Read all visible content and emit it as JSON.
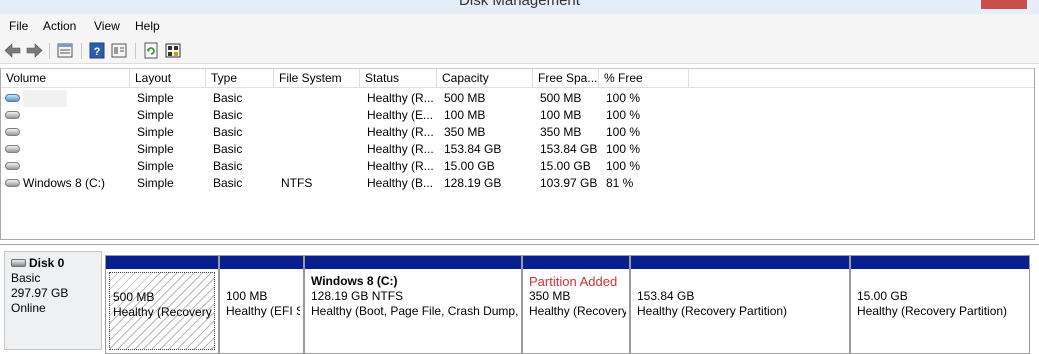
{
  "window": {
    "title": "Disk Management"
  },
  "menu": [
    "File",
    "Action",
    "View",
    "Help"
  ],
  "toolbar": {
    "icons": [
      "back-arrow-icon",
      "forward-arrow-icon",
      "disk-list-icon",
      "help-icon",
      "properties-icon",
      "refresh-icon",
      "rescan-icon"
    ]
  },
  "columns": [
    "Volume",
    "Layout",
    "Type",
    "File System",
    "Status",
    "Capacity",
    "Free Spa...",
    "% Free"
  ],
  "volumes": [
    {
      "volume": "",
      "layout": "Simple",
      "type": "Basic",
      "fs": "",
      "status": "Healthy (R...",
      "capacity": "500 MB",
      "free": "500 MB",
      "pct": "100 %"
    },
    {
      "volume": "",
      "layout": "Simple",
      "type": "Basic",
      "fs": "",
      "status": "Healthy (E...",
      "capacity": "100 MB",
      "free": "100 MB",
      "pct": "100 %"
    },
    {
      "volume": "",
      "layout": "Simple",
      "type": "Basic",
      "fs": "",
      "status": "Healthy (R...",
      "capacity": "350 MB",
      "free": "350 MB",
      "pct": "100 %"
    },
    {
      "volume": "",
      "layout": "Simple",
      "type": "Basic",
      "fs": "",
      "status": "Healthy (R...",
      "capacity": "153.84 GB",
      "free": "153.84 GB",
      "pct": "100 %"
    },
    {
      "volume": "",
      "layout": "Simple",
      "type": "Basic",
      "fs": "",
      "status": "Healthy (R...",
      "capacity": "15.00 GB",
      "free": "15.00 GB",
      "pct": "100 %"
    },
    {
      "volume": "Windows 8 (C:)",
      "layout": "Simple",
      "type": "Basic",
      "fs": "NTFS",
      "status": "Healthy (B...",
      "capacity": "128.19 GB",
      "free": "103.97 GB",
      "pct": "81 %"
    }
  ],
  "disk": {
    "name": "Disk 0",
    "type": "Basic",
    "size": "297.97 GB",
    "state": "Online"
  },
  "partitions": [
    {
      "title": "",
      "size": "500 MB",
      "status": "Healthy (Recovery Partition)"
    },
    {
      "title": "",
      "size": "100 MB",
      "status": "Healthy (EFI System Partition)"
    },
    {
      "title": "Windows 8  (C:)",
      "size": "128.19 GB NTFS",
      "status": "Healthy (Boot, Page File, Crash Dump, Primary Partition)"
    },
    {
      "title": "Partition Added",
      "size": "350 MB",
      "status": "Healthy (Recovery Partition)"
    },
    {
      "title": "",
      "size": "153.84 GB",
      "status": "Healthy (Recovery Partition)"
    },
    {
      "title": "",
      "size": "15.00 GB",
      "status": "Healthy (Recovery Partition)"
    }
  ],
  "colors": {
    "partition_bar": "#0a1f8f",
    "added_text": "#cc3333"
  }
}
